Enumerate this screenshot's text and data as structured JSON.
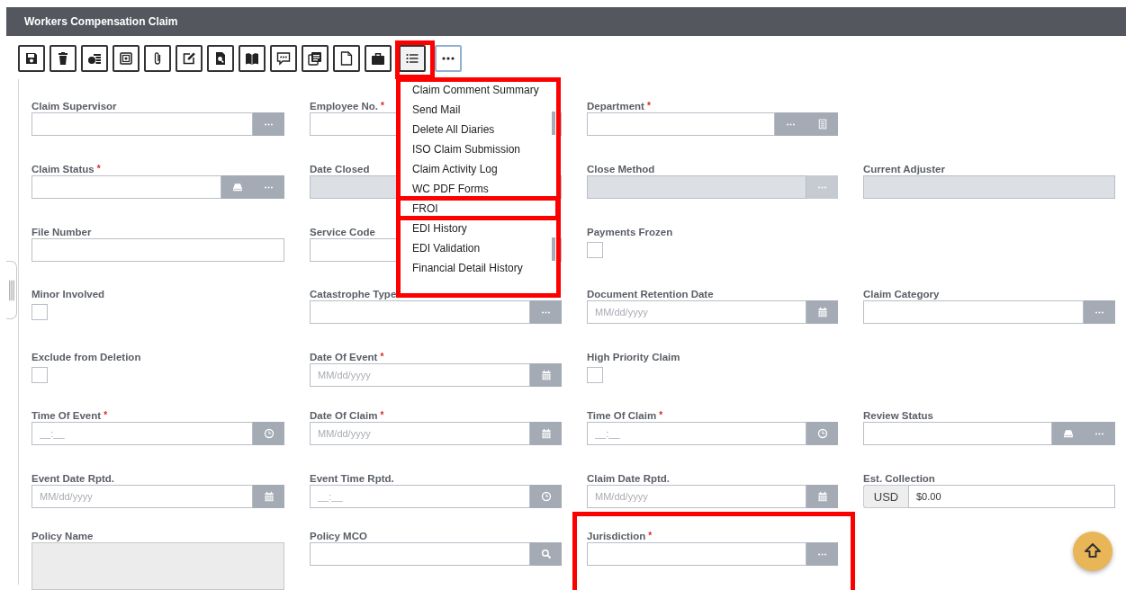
{
  "window": {
    "title": "Workers Compensation Claim"
  },
  "toolbar": {
    "menu": {
      "expanded": true,
      "highlighted": true,
      "dropdown_highlighted": true,
      "items": [
        {
          "label": "Claim Comment Summary",
          "highlighted": false
        },
        {
          "label": "Send Mail",
          "highlighted": false
        },
        {
          "label": "Delete All Diaries",
          "highlighted": false
        },
        {
          "label": "ISO Claim Submission",
          "highlighted": false
        },
        {
          "label": "Claim Activity Log",
          "highlighted": false
        },
        {
          "label": "WC PDF Forms",
          "highlighted": false
        },
        {
          "label": "FROI",
          "highlighted": true
        },
        {
          "label": "EDI History",
          "highlighted": false
        },
        {
          "label": "EDI Validation",
          "highlighted": false
        },
        {
          "label": "Financial Detail History",
          "highlighted": false
        }
      ]
    }
  },
  "form": {
    "required_mark": "*",
    "rows": [
      [
        {
          "label": "Claim Supervisor",
          "required": false,
          "kind": "text",
          "disabled": false,
          "buttons": [
            {
              "kind": "ellipsis"
            }
          ]
        },
        {
          "label": "Employee No.",
          "required": true,
          "kind": "text",
          "disabled": false
        },
        {
          "label": "Department",
          "required": true,
          "kind": "text",
          "disabled": false,
          "buttons": [
            {
              "kind": "ellipsis"
            },
            {
              "kind": "list"
            }
          ]
        },
        null
      ],
      [
        {
          "label": "Claim Status",
          "required": true,
          "kind": "text",
          "disabled": false,
          "buttons": [
            {
              "kind": "tray"
            },
            {
              "kind": "ellipsis"
            }
          ]
        },
        {
          "label": "Date Closed",
          "required": false,
          "kind": "text",
          "disabled": true
        },
        {
          "label": "Close Method",
          "required": false,
          "kind": "text",
          "disabled": true,
          "buttons": [
            {
              "kind": "ellipsis"
            }
          ]
        },
        {
          "label": "Current Adjuster",
          "required": false,
          "kind": "text",
          "disabled": true
        }
      ],
      [
        {
          "label": "File Number",
          "required": false,
          "kind": "text",
          "disabled": false
        },
        {
          "label": "Service Code",
          "required": false,
          "kind": "text",
          "disabled": false
        },
        {
          "label": "Payments Frozen",
          "required": false,
          "kind": "checkbox",
          "checked": false
        },
        null
      ],
      [
        {
          "label": "Minor Involved",
          "required": false,
          "kind": "checkbox",
          "checked": false
        },
        {
          "label": "Catastrophe Type",
          "required": false,
          "kind": "text",
          "disabled": false,
          "buttons": [
            {
              "kind": "ellipsis"
            }
          ]
        },
        {
          "label": "Document Retention Date",
          "required": false,
          "kind": "text",
          "disabled": false,
          "placeholder": "MM/dd/yyyy",
          "buttons": [
            {
              "kind": "calendar"
            }
          ]
        },
        {
          "label": "Claim Category",
          "required": false,
          "kind": "text",
          "disabled": false,
          "buttons": [
            {
              "kind": "ellipsis"
            }
          ]
        }
      ],
      [
        {
          "label": "Exclude from Deletion",
          "required": false,
          "kind": "checkbox",
          "checked": false
        },
        {
          "label": "Date Of Event",
          "required": true,
          "kind": "text",
          "disabled": false,
          "placeholder": "MM/dd/yyyy",
          "buttons": [
            {
              "kind": "calendar"
            }
          ]
        },
        {
          "label": "High Priority Claim",
          "required": false,
          "kind": "checkbox",
          "checked": false
        },
        null
      ],
      [
        {
          "label": "Time Of Event",
          "required": true,
          "kind": "text",
          "disabled": false,
          "placeholder": "__:__",
          "buttons": [
            {
              "kind": "clock"
            }
          ]
        },
        {
          "label": "Date Of Claim",
          "required": true,
          "kind": "text",
          "disabled": false,
          "placeholder": "MM/dd/yyyy",
          "buttons": [
            {
              "kind": "calendar"
            }
          ]
        },
        {
          "label": "Time Of Claim",
          "required": true,
          "kind": "text",
          "disabled": false,
          "placeholder": "__:__",
          "buttons": [
            {
              "kind": "clock"
            }
          ]
        },
        {
          "label": "Review Status",
          "required": false,
          "kind": "text",
          "disabled": false,
          "buttons": [
            {
              "kind": "tray"
            },
            {
              "kind": "ellipsis"
            }
          ]
        }
      ],
      [
        {
          "label": "Event Date Rptd.",
          "required": false,
          "kind": "text",
          "disabled": false,
          "placeholder": "MM/dd/yyyy",
          "buttons": [
            {
              "kind": "calendar"
            }
          ]
        },
        {
          "label": "Event Time Rptd.",
          "required": false,
          "kind": "text",
          "disabled": false,
          "placeholder": "__:__",
          "buttons": [
            {
              "kind": "clock"
            }
          ]
        },
        {
          "label": "Claim Date Rptd.",
          "required": false,
          "kind": "text",
          "disabled": false,
          "placeholder": "MM/dd/yyyy",
          "buttons": [
            {
              "kind": "calendar"
            }
          ]
        },
        {
          "label": "Est. Collection",
          "required": false,
          "kind": "currency",
          "prefix": "USD",
          "value": "$0.00"
        }
      ],
      [
        {
          "label": "Policy Name",
          "required": false,
          "kind": "textarea",
          "disabled": true
        },
        {
          "label": "Policy MCO",
          "required": false,
          "kind": "text",
          "disabled": false,
          "buttons": [
            {
              "kind": "search"
            }
          ]
        },
        {
          "label": "Jurisdiction",
          "required": true,
          "kind": "text",
          "disabled": false,
          "highlighted": true,
          "buttons": [
            {
              "kind": "ellipsis"
            }
          ]
        },
        null
      ]
    ]
  }
}
